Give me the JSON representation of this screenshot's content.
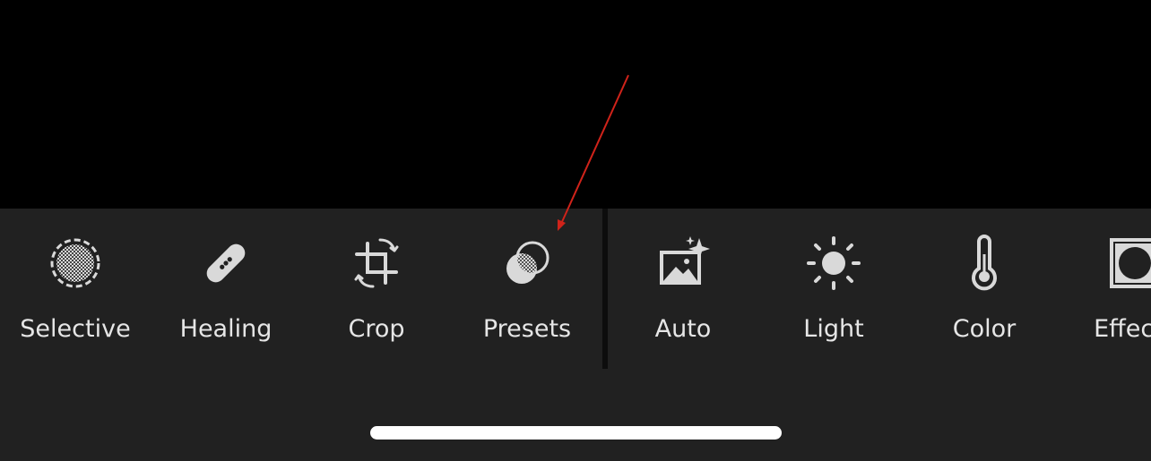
{
  "toolbar": {
    "tools": [
      {
        "label": "Selective",
        "icon": "selective-icon"
      },
      {
        "label": "Healing",
        "icon": "bandage-icon"
      },
      {
        "label": "Crop",
        "icon": "crop-rotate-icon"
      },
      {
        "label": "Presets",
        "icon": "presets-icon"
      },
      {
        "label": "Auto",
        "icon": "auto-image-sparkle-icon"
      },
      {
        "label": "Light",
        "icon": "sun-icon"
      },
      {
        "label": "Color",
        "icon": "thermometer-icon"
      },
      {
        "label": "Effects",
        "icon": "vignette-icon"
      }
    ]
  },
  "colors": {
    "toolbar_bg": "#212121",
    "background": "#000000",
    "label": "#e6e6e6",
    "icon": "#d9d9d9",
    "annotation_arrow": "#d0231a"
  }
}
